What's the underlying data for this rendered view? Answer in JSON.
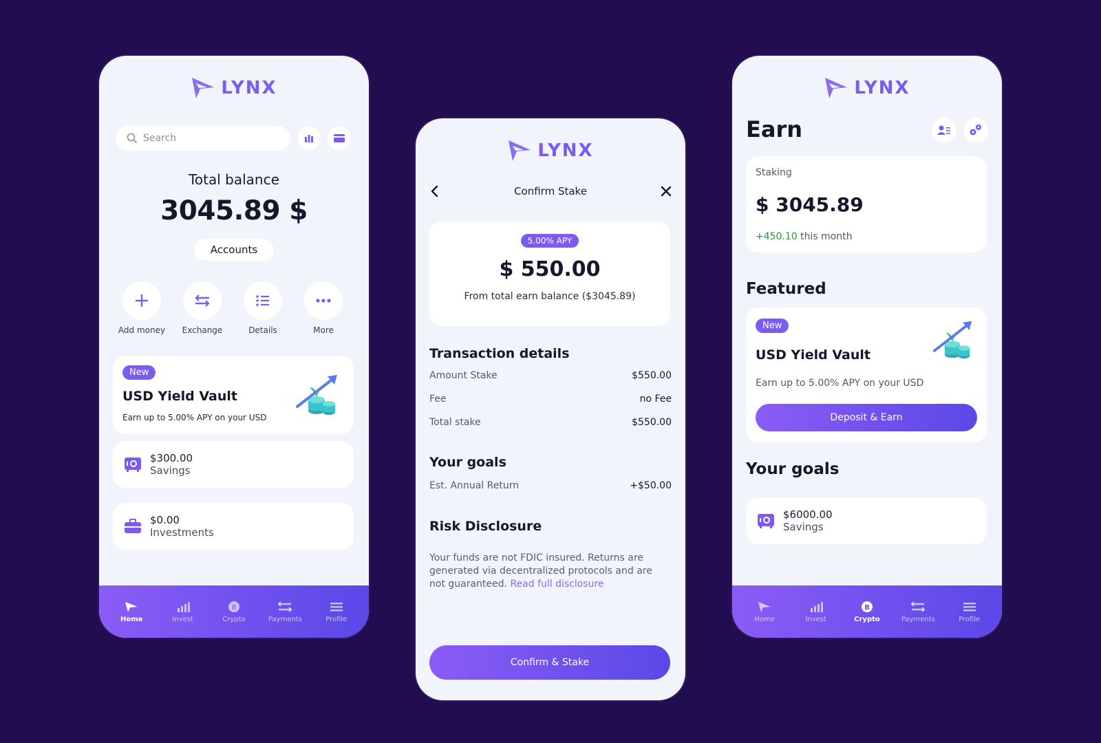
{
  "brand": {
    "name": "LYNX",
    "accent": "#7c5cf0",
    "background": "#220d51"
  },
  "home": {
    "search_placeholder": "Search",
    "total_label": "Total balance",
    "total_value": "3045.89 $",
    "accounts_label": "Accounts",
    "actions": [
      {
        "label": "Add money",
        "icon": "plus-icon"
      },
      {
        "label": "Exchange",
        "icon": "exchange-icon"
      },
      {
        "label": "Details",
        "icon": "list-icon"
      },
      {
        "label": "More",
        "icon": "more-icon"
      }
    ],
    "vault": {
      "badge": "New",
      "title": "USD Yield Vault",
      "subtitle": "Earn up to 5.00% APY on your USD"
    },
    "accounts": [
      {
        "amount": "$300.00",
        "name": "Savings",
        "icon": "safe-icon"
      },
      {
        "amount": "$0.00",
        "name": "Investments",
        "icon": "briefcase-icon"
      }
    ]
  },
  "tabs": [
    "Home",
    "Invest",
    "Crypto",
    "Payments",
    "Profile"
  ],
  "stake": {
    "title": "Confirm Stake",
    "apy": "5.00% APY",
    "amount": "$ 550.00",
    "from": "From total earn balance ($3045.89)",
    "transaction_title": "Transaction details",
    "rows": [
      {
        "label": "Amount Stake",
        "value": "$550.00"
      },
      {
        "label": "Fee",
        "value": "no Fee"
      },
      {
        "label": "Total stake",
        "value": "$550.00"
      }
    ],
    "goals_title": "Your goals",
    "goal_row": {
      "label": "Est. Annual Return",
      "value": "+$50.00"
    },
    "risk_title": "Risk Disclosure",
    "risk_text": "Your funds are not FDIC insured. Returns are generated via decentralized protocols and are not guaranteed.",
    "risk_link": "Read full disclosure",
    "button": "Confirm & Stake"
  },
  "earn": {
    "title": "Earn",
    "staking_label": "Staking",
    "staking_value": "$ 3045.89",
    "month_delta": "+450.10",
    "month_suffix": "this month",
    "featured_title": "Featured",
    "vault": {
      "badge": "New",
      "title": "USD Yield Vault",
      "subtitle": "Earn up to 5.00% APY on your USD",
      "button": "Deposit & Earn"
    },
    "goals_title": "Your goals",
    "goal": {
      "amount": "$6000.00",
      "name": "Savings"
    }
  }
}
